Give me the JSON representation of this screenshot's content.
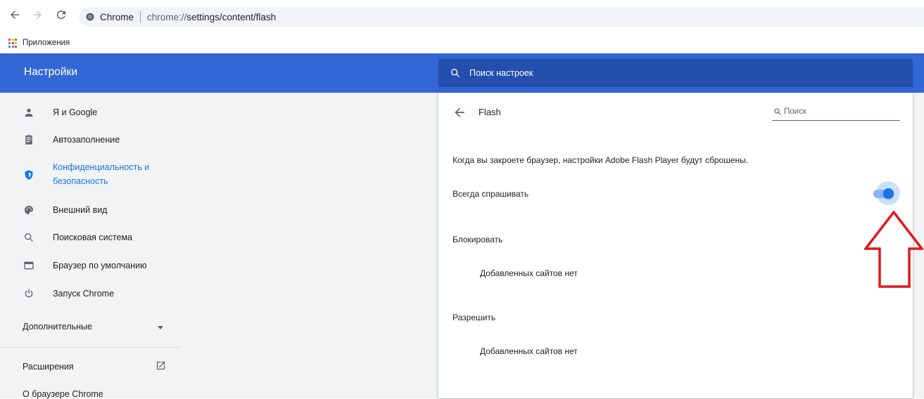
{
  "browser": {
    "site_label": "Chrome",
    "url_scheme": "chrome://",
    "url_path": "settings/content/flash",
    "bookmarks_apps_label": "Приложения"
  },
  "header": {
    "title": "Настройки",
    "search_placeholder": "Поиск настроек"
  },
  "sidebar": {
    "items": [
      {
        "label": "Я и Google",
        "icon": "person-icon"
      },
      {
        "label": "Автозаполнение",
        "icon": "clipboard-icon"
      },
      {
        "label": "Конфиденциальность и",
        "label2": "безопасность",
        "icon": "shield-icon",
        "active": true
      },
      {
        "label": "Внешний вид",
        "icon": "palette-icon"
      },
      {
        "label": "Поисковая система",
        "icon": "search-icon"
      },
      {
        "label": "Браузер по умолчанию",
        "icon": "browser-window-icon"
      },
      {
        "label": "Запуск Chrome",
        "icon": "power-icon"
      }
    ],
    "advanced_label": "Дополнительные",
    "extensions_label": "Расширения",
    "about_label": "О браузере Chrome"
  },
  "flash_page": {
    "title": "Flash",
    "search_placeholder": "Поиск",
    "notice": "Когда вы закроете браузер, настройки Adobe Flash Player будут сброшены.",
    "always_ask_label": "Всегда спрашивать",
    "always_ask_enabled": true,
    "block_heading": "Блокировать",
    "block_empty": "Добавленных сайтов нет",
    "allow_heading": "Разрешить",
    "allow_empty": "Добавленных сайтов нет"
  },
  "colors": {
    "header_blue": "#3367d6",
    "search_bar_blue": "#254fae",
    "accent_blue": "#1a73e8",
    "annotation_red": "#e0191f"
  }
}
